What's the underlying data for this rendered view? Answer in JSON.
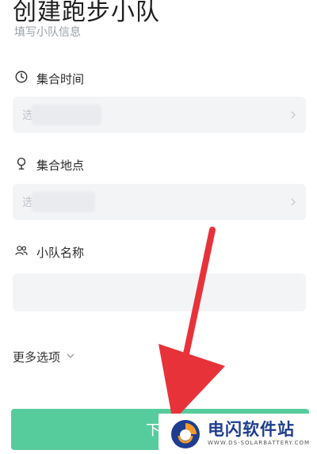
{
  "header": {
    "title": "创建跑步小队",
    "subtitle": "填写小队信息"
  },
  "form": {
    "meet_time": {
      "label": "集合时间",
      "value": "选"
    },
    "meet_place": {
      "label": "集合地点",
      "value": "选"
    },
    "team_name": {
      "label": "小队名称",
      "value": ""
    }
  },
  "more_options": {
    "label": "更多选项"
  },
  "next_button": {
    "label": "下一"
  },
  "watermark": {
    "cn": "电闪软件站",
    "en": "WWW.DS-SOLARBATTERY.COM"
  },
  "colors": {
    "accent": "#56cc9d",
    "arrow": "#e8323a",
    "brand_blue": "#1e3d8f",
    "brand_orange": "#f39b2a"
  },
  "icons": {
    "time": "clock-icon",
    "place": "location-pin-icon",
    "team": "group-icon",
    "more": "chevron-down-icon"
  }
}
